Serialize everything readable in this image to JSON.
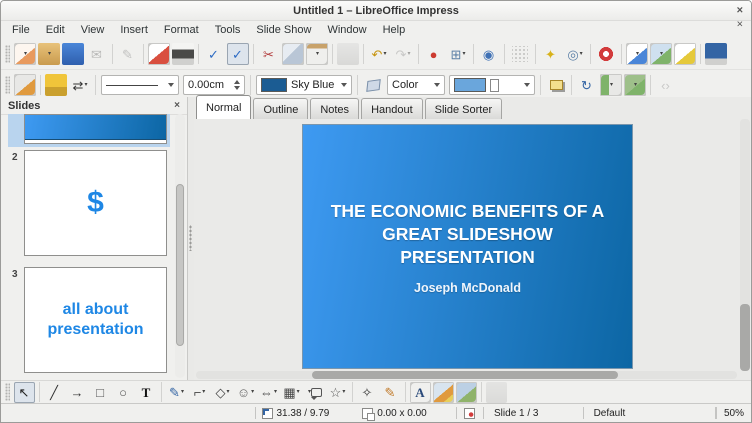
{
  "colors": {
    "accent_blue": "#1e87e5",
    "slide_gradient_from": "#3e9af2",
    "slide_gradient_to": "#0c66a4",
    "line_color_swatch": "#1b5c93",
    "fill_color_swatch": "#6aa6dc"
  },
  "titlebar": {
    "title": "Untitled 1 – LibreOffice Impress",
    "close": "×"
  },
  "menubar": {
    "items": [
      "File",
      "Edit",
      "View",
      "Insert",
      "Format",
      "Tools",
      "Slide Show",
      "Window",
      "Help"
    ],
    "close": "×"
  },
  "toolbar1": {
    "items": [
      {
        "n": "new-document-icon",
        "cls": "ic brd",
        "t": "linear-gradient(140deg,#fdf6ef 55%,#e89a5e 55%)",
        "dd": "▾",
        "ia": "true"
      },
      {
        "n": "open-folder-icon",
        "cls": "ic",
        "t": "linear-gradient(180deg,#e8c27a,#c99b4e)",
        "dd": "▾",
        "ia": "true"
      },
      {
        "n": "save-icon",
        "cls": "ic",
        "t": "linear-gradient(180deg,#4a86d8,#2f5fae)",
        "ia": "true"
      },
      {
        "n": "email-icon",
        "cls": "ic dis",
        "g": "✉",
        "c": "#777",
        "ia": "true"
      },
      {
        "n": "separator",
        "cls": "sep",
        "ia": "false"
      },
      {
        "n": "edit-file-icon",
        "cls": "ic dis",
        "g": "✎",
        "c": "#888",
        "ia": "true"
      },
      {
        "n": "separator",
        "cls": "sep",
        "ia": "false"
      },
      {
        "n": "export-pdf-icon",
        "cls": "ic brd",
        "t": "linear-gradient(140deg,#ffffff 50%,#d94f3f 50%)",
        "ia": "true"
      },
      {
        "n": "print-icon",
        "cls": "ic",
        "t": "linear-gradient(180deg,#f4f4f2 30%,#4a4a48 30%,#4a4a48 70%,#d0d0ce 70%)",
        "ia": "true"
      },
      {
        "n": "separator",
        "cls": "sep",
        "ia": "false"
      },
      {
        "n": "spellcheck-icon",
        "cls": "ic",
        "g": "✓",
        "c": "#2d6bc4",
        "ia": "true"
      },
      {
        "n": "auto-spellcheck-icon",
        "cls": "ic pressed",
        "g": "✓",
        "c": "#2d6bc4",
        "ia": "true"
      },
      {
        "n": "separator",
        "cls": "sep",
        "ia": "false"
      },
      {
        "n": "cut-icon",
        "cls": "ic",
        "g": "✂",
        "c": "#b23b3b",
        "ia": "true"
      },
      {
        "n": "copy-icon",
        "cls": "ic brd",
        "t": "linear-gradient(135deg,#e7ecf2 45%,#b9c6d6 45%)",
        "ia": "true"
      },
      {
        "n": "paste-icon",
        "cls": "ic brd",
        "t": "linear-gradient(180deg,#c8a26a 25%,#efefed 25%)",
        "dd": "▾",
        "ia": "true"
      },
      {
        "n": "separator",
        "cls": "sep",
        "ia": "false"
      },
      {
        "n": "clone-formatting-icon",
        "cls": "ic dis",
        "t": "linear-gradient(180deg,#d9d9d7,#bdbdbb)",
        "ia": "true"
      },
      {
        "n": "separator",
        "cls": "sep",
        "ia": "false"
      },
      {
        "n": "undo-icon",
        "cls": "ic",
        "g": "↶",
        "c": "#c79510",
        "dd": "▾",
        "ia": "true"
      },
      {
        "n": "redo-icon",
        "cls": "ic dis",
        "g": "↷",
        "c": "#999",
        "dd": "▾",
        "ia": "true"
      },
      {
        "n": "separator",
        "cls": "sep",
        "ia": "false"
      },
      {
        "n": "chart-icon",
        "cls": "ic",
        "g": "●",
        "c": "#cc3b30",
        "ia": "true"
      },
      {
        "n": "table-icon",
        "cls": "ic",
        "g": "⊞",
        "c": "#5b7fa6",
        "dd": "▾",
        "ia": "true"
      },
      {
        "n": "separator",
        "cls": "sep",
        "ia": "false"
      },
      {
        "n": "hyperlink-icon",
        "cls": "ic",
        "g": "◉",
        "c": "#3f71b5",
        "ia": "true"
      },
      {
        "n": "separator",
        "cls": "sep",
        "ia": "false"
      },
      {
        "n": "display-grid-icon",
        "cls": "ic dis dots",
        "ia": "true"
      },
      {
        "n": "separator",
        "cls": "sep",
        "ia": "false"
      },
      {
        "n": "navigator-icon",
        "cls": "ic",
        "g": "✦",
        "c": "#d8b21a",
        "ia": "true"
      },
      {
        "n": "zoom-icon",
        "cls": "ic",
        "g": "◎",
        "c": "#5b7fa6",
        "dd": "▾",
        "ia": "true"
      },
      {
        "n": "separator",
        "cls": "sep",
        "ia": "false"
      },
      {
        "n": "help-icon",
        "cls": "ic",
        "t": "radial-gradient(circle at 50% 50%, #ffffff 0 3px, #d23b3b 3px 7px, transparent 7px)",
        "ia": "true"
      },
      {
        "n": "separator",
        "cls": "sep",
        "ia": "false"
      },
      {
        "n": "new-slide-icon",
        "cls": "ic brd",
        "t": "linear-gradient(140deg,#ffffff 55%,#4a86d8 55%)",
        "dd": "▾",
        "ia": "true"
      },
      {
        "n": "slide-layout-icon",
        "cls": "ic brd",
        "t": "linear-gradient(140deg,#cfe0ef 55%,#7fb36a 55%)",
        "dd": "▾",
        "ia": "true"
      },
      {
        "n": "slide-design-icon",
        "cls": "ic brd",
        "t": "linear-gradient(140deg,#ffffff 55%,#e5c93a 55%)",
        "ia": "true"
      },
      {
        "n": "separator",
        "cls": "sep",
        "ia": "false"
      },
      {
        "n": "start-presentation-icon",
        "cls": "ic",
        "t": "linear-gradient(180deg,#3465a4 70%,#d0d0ce 70%)",
        "ia": "true"
      }
    ]
  },
  "toolbar2": {
    "icons_a": [
      {
        "n": "styles-window-icon",
        "cls": "ic brd",
        "t": "linear-gradient(140deg,#e8e8e6 55%,#e09a3e 55%)",
        "ia": "true"
      },
      {
        "n": "separator",
        "cls": "sep",
        "ia": "false"
      },
      {
        "n": "spray-can-icon",
        "cls": "ic",
        "t": "linear-gradient(180deg,#f0c53a 60%,#caa02e 60%)",
        "ia": "true"
      },
      {
        "n": "arrow-style-icon",
        "cls": "ic",
        "g": "⇄",
        "c": "#333",
        "dd": "▾",
        "ia": "true"
      },
      {
        "n": "separator",
        "cls": "sep",
        "ia": "false"
      }
    ],
    "line_width": "0.00cm",
    "line_color_label": "Sky Blue",
    "fill_style_label": "Color",
    "icons_b": [
      {
        "n": "paint-bucket-icon",
        "cls": "ic bucket",
        "ia": "true"
      }
    ],
    "icons_c": [
      {
        "n": "shadow-icon",
        "cls": "ic shadowic",
        "ia": "true"
      },
      {
        "n": "separator",
        "cls": "sep",
        "ia": "false"
      },
      {
        "n": "rotate-icon",
        "cls": "ic",
        "g": "↻",
        "c": "#3465a4",
        "ia": "true"
      },
      {
        "n": "align-icon",
        "cls": "ic brd",
        "t": "linear-gradient(90deg,#7fb36a 40%,#e8e8e6 40%)",
        "dd": "▾",
        "ia": "true"
      },
      {
        "n": "arrange-icon",
        "cls": "ic brd",
        "t": "linear-gradient(140deg,#9ec08a 55%,#7fb36a 55%)",
        "dd": "▾",
        "ia": "true"
      },
      {
        "n": "separator",
        "cls": "sep",
        "ia": "false"
      },
      {
        "n": "points-icon",
        "cls": "ic dis",
        "g": "‹›",
        "c": "#999",
        "ia": "true"
      }
    ]
  },
  "slides_panel": {
    "title": "Slides",
    "close": "×",
    "slide2": {
      "number": "2",
      "content": "$"
    },
    "slide3": {
      "number": "3",
      "content": "all about presentation"
    }
  },
  "tabs": {
    "items": [
      {
        "label": "Normal",
        "cls": "tab active",
        "n": "tab-normal",
        "ia": "true"
      },
      {
        "label": "Outline",
        "cls": "tab",
        "n": "tab-outline",
        "ia": "true"
      },
      {
        "label": "Notes",
        "cls": "tab",
        "n": "tab-notes",
        "ia": "true"
      },
      {
        "label": "Handout",
        "cls": "tab",
        "n": "tab-handout",
        "ia": "true"
      },
      {
        "label": "Slide Sorter",
        "cls": "tab",
        "n": "tab-slide-sorter",
        "ia": "true"
      }
    ]
  },
  "slide": {
    "title": "THE ECONOMIC BENEFITS OF A GREAT SLIDESHOW PRESENTATION",
    "subtitle": "Joseph McDonald"
  },
  "drawbar": {
    "items": [
      {
        "n": "select-arrow-icon",
        "cls": "ic pressed",
        "g": "↖",
        "c": "#222",
        "ia": "true"
      },
      {
        "n": "separator",
        "cls": "sep",
        "ia": "false"
      },
      {
        "n": "line-icon",
        "cls": "ic",
        "g": "╱",
        "c": "#333",
        "ia": "true"
      },
      {
        "n": "arrow-icon",
        "cls": "ic",
        "g": "→",
        "c": "#333",
        "ia": "true"
      },
      {
        "n": "rectangle-icon",
        "cls": "ic",
        "g": "□",
        "c": "#555",
        "ia": "true"
      },
      {
        "n": "ellipse-icon",
        "cls": "ic",
        "g": "○",
        "c": "#555",
        "ia": "true"
      },
      {
        "n": "text-box-icon",
        "cls": "ic boldT",
        "g": "T",
        "c": "#111",
        "ia": "true"
      },
      {
        "n": "separator",
        "cls": "sep",
        "ia": "false"
      },
      {
        "n": "curve-icon",
        "cls": "ic",
        "g": "✎",
        "c": "#3465a4",
        "dd": "▾",
        "ia": "true"
      },
      {
        "n": "connector-icon",
        "cls": "ic",
        "g": "⌐",
        "c": "#444",
        "dd": "▾",
        "ia": "true"
      },
      {
        "n": "basic-shapes-icon",
        "cls": "ic",
        "g": "◇",
        "c": "#444",
        "dd": "▾",
        "ia": "true"
      },
      {
        "n": "symbol-shapes-icon",
        "cls": "ic",
        "g": "☺",
        "c": "#666",
        "dd": "▾",
        "ia": "true"
      },
      {
        "n": "block-arrows-icon",
        "cls": "ic",
        "g": "⇔",
        "c": "#444",
        "dd": "▾",
        "ia": "true"
      },
      {
        "n": "flowchart-icon",
        "cls": "ic",
        "g": "▦",
        "c": "#444",
        "dd": "▾",
        "ia": "true"
      },
      {
        "n": "callouts-icon",
        "cls": "ic bubble",
        "dd": "▾",
        "ia": "true"
      },
      {
        "n": "stars-icon",
        "cls": "ic",
        "g": "☆",
        "c": "#555",
        "dd": "▾",
        "ia": "true"
      },
      {
        "n": "separator",
        "cls": "sep",
        "ia": "false"
      },
      {
        "n": "edit-points-icon",
        "cls": "ic",
        "g": "✧",
        "c": "#333",
        "ia": "true"
      },
      {
        "n": "glue-points-icon",
        "cls": "ic",
        "g": "✎",
        "c": "#c07a2a",
        "ia": "true"
      },
      {
        "n": "separator",
        "cls": "sep",
        "ia": "false"
      },
      {
        "n": "fontwork-icon",
        "cls": "ic brd boldT",
        "g": "A",
        "c": "#2a4a7a",
        "ia": "true"
      },
      {
        "n": "insert-image-icon",
        "cls": "ic brd",
        "t": "linear-gradient(140deg,#d8e4ef 50%,#e09a3e 50%,#e09a3e 75%,#e8cf5a 75%)",
        "ia": "true"
      },
      {
        "n": "gallery-icon",
        "cls": "ic brd",
        "t": "linear-gradient(140deg,#bcd0e4 55%,#8fb36a 55%)",
        "ia": "true"
      },
      {
        "n": "separator",
        "cls": "sep",
        "ia": "false"
      },
      {
        "n": "toggle-3d-icon",
        "cls": "ic dis",
        "t": "linear-gradient(180deg,#d5d5d3,#c2c2c0)",
        "ia": "true"
      }
    ]
  },
  "statusbar": {
    "position": "31.38 / 9.79",
    "size": "0.00 x 0.00",
    "slide": "Slide 1 / 3",
    "style": "Default",
    "zoom": "50%"
  }
}
